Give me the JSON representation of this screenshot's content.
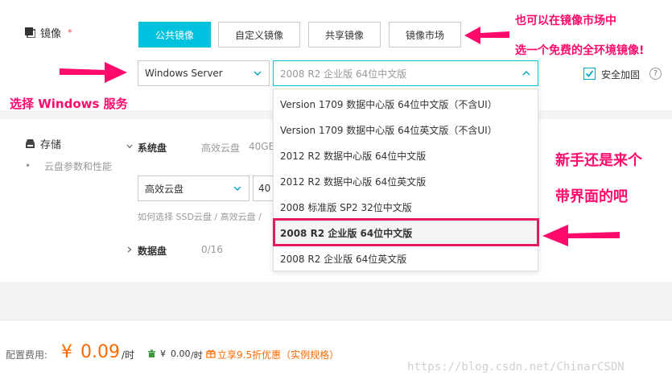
{
  "image_section": {
    "label": "镜像",
    "required_mark": "*",
    "tabs": [
      {
        "label": "公共镜像",
        "active": true
      },
      {
        "label": "自定义镜像",
        "active": false
      },
      {
        "label": "共享镜像",
        "active": false
      },
      {
        "label": "镜像市场",
        "active": false
      }
    ],
    "os_select": {
      "value": "Windows Server"
    },
    "version_select": {
      "value": "2008 R2 企业版 64位中文版"
    },
    "security_checkbox": {
      "label": "安全加固",
      "checked": true
    },
    "help_icon": "?"
  },
  "version_dropdown": {
    "options": [
      "Version 1709 数据中心版 64位中文版（不含UI）",
      "Version 1709 数据中心版 64位英文版（不含UI）",
      "2012 R2 数据中心版 64位中文版",
      "2012 R2 数据中心版 64位英文版",
      "2008 标准版 SP2 32位中文版",
      "2008 R2 企业版 64位中文版",
      "2008 R2 企业版 64位英文版"
    ],
    "selected_index": 5
  },
  "storage_section": {
    "label": "存储",
    "sub_label": "云盘参数和性能",
    "system_disk": {
      "label": "系统盘",
      "summary_type": "高效云盘",
      "summary_size": "40GB",
      "type_select": "高效云盘",
      "size_value": "40",
      "hint": "如何选择 SSD云盘 / 高效云盘 /"
    },
    "data_disk": {
      "label": "数据盘",
      "count": "0/16"
    }
  },
  "price_bar": {
    "label": "配置费用:",
    "currency": "¥",
    "amount": "0.09",
    "unit": "/时",
    "secondary_currency": "¥",
    "secondary_amount": "0.00",
    "secondary_unit": "/时",
    "discount_text": "立享9.5折优惠（实例规格）"
  },
  "annotations": {
    "top_right_line1": "也可以在镜像市场中",
    "top_right_line2": "选一个免费的全环境镜像!",
    "left": "选择 Windows 服务",
    "right_line1": "新手还是来个",
    "right_line2": "带界面的吧"
  },
  "watermark": "https://blog.csdn.net/ChinarCSDN",
  "colors": {
    "accent": "#00c1de",
    "annotation": "#ff0a6c",
    "price": "#ff6a00"
  },
  "icons": [
    "image-icon",
    "storage-icon",
    "chevron-down-icon",
    "chevron-up-icon",
    "chevron-right-icon",
    "check-icon",
    "help-icon",
    "gift-icon",
    "trash-icon"
  ]
}
